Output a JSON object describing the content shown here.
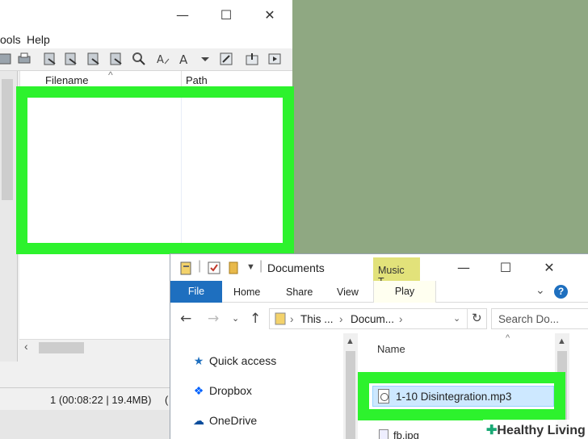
{
  "app_window": {
    "menu": [
      "ools",
      "Help"
    ],
    "columns": [
      "Filename",
      "Path"
    ],
    "status": {
      "count": "1 (00:08:22 | 19.4MB)",
      "tail": "("
    }
  },
  "explorer": {
    "title": "Documents",
    "contextual_tab": "Music T...",
    "ribbon": {
      "file": "File",
      "tabs": [
        "Home",
        "Share",
        "View"
      ],
      "play": "Play"
    },
    "address": {
      "segments": [
        "This ...",
        "Docum..."
      ]
    },
    "search_placeholder": "Search Do...",
    "nav": [
      "Quick access",
      "Dropbox",
      "OneDrive"
    ],
    "column_header": "Name",
    "selected_file": "1-10 Disintegration.mp3",
    "next_file": "fb.jpg"
  },
  "watermark": {
    "plus": "✚",
    "text": "Healthy Living"
  },
  "colors": {
    "highlight": "#2df22d",
    "accent": "#1e6fbf",
    "desktop": "#8fa882"
  }
}
